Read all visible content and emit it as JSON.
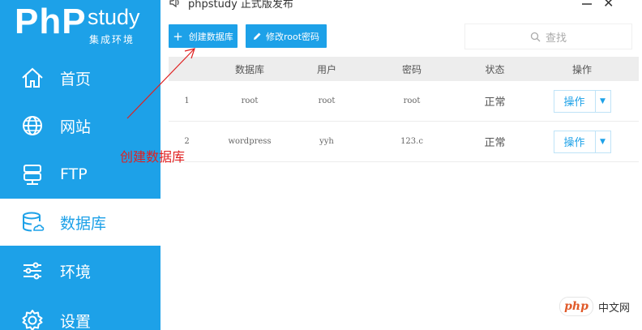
{
  "app": {
    "title": "phpstudy 正式版发布",
    "logo_main": "PhP",
    "logo_study": "study",
    "logo_sub": "集成环境"
  },
  "sidebar": {
    "items": [
      {
        "label": "首页",
        "icon": "home-icon",
        "active": false
      },
      {
        "label": "网站",
        "icon": "globe-icon",
        "active": false
      },
      {
        "label": "FTP",
        "icon": "ftp-server-icon",
        "active": false
      },
      {
        "label": "数据库",
        "icon": "database-icon",
        "active": true
      },
      {
        "label": "环境",
        "icon": "sliders-icon",
        "active": false
      },
      {
        "label": "设置",
        "icon": "gear-icon",
        "active": false
      }
    ]
  },
  "toolbar": {
    "create_db_label": "创建数据库",
    "create_db_icon": "+",
    "change_root_label": "修改root密码",
    "search_placeholder": "查找"
  },
  "table": {
    "headers": [
      "",
      "数据库",
      "用户",
      "密码",
      "状态",
      "操作"
    ],
    "rows": [
      {
        "index": "1",
        "database": "root",
        "user": "root",
        "password": "root",
        "status": "正常",
        "action": "操作"
      },
      {
        "index": "2",
        "database": "wordpress",
        "user": "yyh",
        "password": "123.c",
        "status": "正常",
        "action": "操作"
      }
    ]
  },
  "annotation": {
    "text": "创建数据库"
  },
  "watermark": {
    "badge": "php",
    "text": "中文网"
  },
  "colors": {
    "accent": "#1da1e8",
    "annotation": "#e02020"
  }
}
